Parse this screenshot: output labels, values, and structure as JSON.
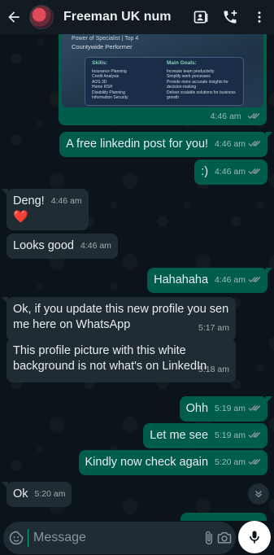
{
  "header": {
    "contact_name": "Freeman UK num",
    "icons": [
      "back-arrow-icon",
      "video-call-icon",
      "add-call-icon",
      "more-vert-icon"
    ]
  },
  "image_message": {
    "top_text": "Power   of   Specialist   |   Top 4",
    "subtitle": "Countywide Performer",
    "skills_heading": "Skills:",
    "skills": [
      "Insurance Planning",
      "Credit Analysis",
      "AOS 3D",
      "Home RSH",
      "Disability Planning",
      "Information Security"
    ],
    "goals_heading": "Main Goals:",
    "goals": [
      "Increase team productivity",
      "Simplify work processes",
      "Provide more accurate insights for decision-making",
      "Deliver scalable solutions for business growth"
    ],
    "time": "4:46 am"
  },
  "messages": [
    {
      "dir": "out",
      "text": "A free linkedin post for you!",
      "time": "4:46 am"
    },
    {
      "dir": "out",
      "text": ":)",
      "time": "4:46 am"
    },
    {
      "dir": "in",
      "text": "Deng!",
      "time": "4:46 am",
      "emoji": "❤️"
    },
    {
      "dir": "in",
      "text": "Looks good",
      "time": "4:46 am"
    },
    {
      "dir": "out",
      "text": "Hahahaha",
      "time": "4:46 am"
    },
    {
      "dir": "in",
      "text": "Ok, if you update this new profile you sen me here on WhatsApp",
      "time": "5:17 am"
    },
    {
      "dir": "in",
      "text": "This profile picture with this white background is not what's on LinkedIn",
      "time": "5:18 am"
    },
    {
      "dir": "out",
      "text": "Ohh",
      "time": "5:19 am"
    },
    {
      "dir": "out",
      "text": "Let me see",
      "time": "5:19 am"
    },
    {
      "dir": "out",
      "text": "Kindly now check again",
      "time": "5:20 am"
    },
    {
      "dir": "in",
      "text": "Ok",
      "time": "5:20 am"
    }
  ],
  "composer": {
    "placeholder": "Message"
  },
  "colors": {
    "background": "#0b141a",
    "outgoing_bubble": "#005c4b",
    "incoming_bubble": "#202c33",
    "accent": "#00a884",
    "read_ticks": "#53bdeb"
  }
}
